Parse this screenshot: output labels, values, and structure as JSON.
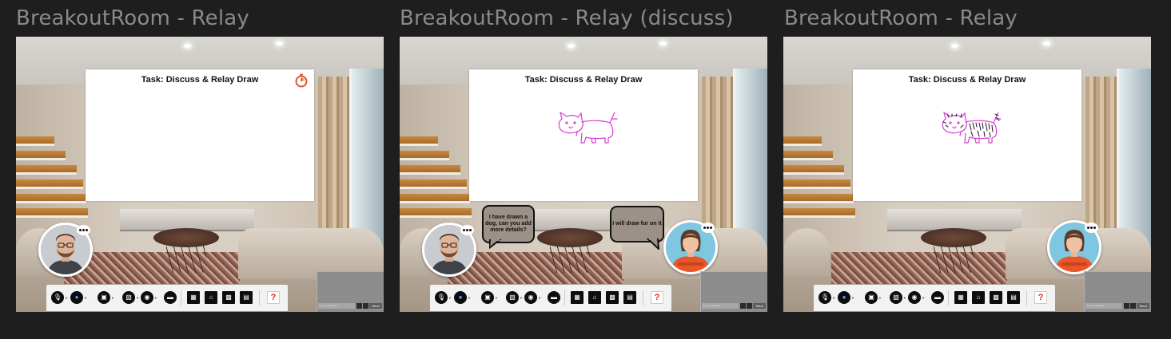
{
  "frames": [
    {
      "title": "BreakoutRoom - Relay",
      "board_title": "Task: Discuss & Relay Draw",
      "timer_icon": "stopwatch-icon",
      "drawing": "none",
      "participants": [
        "man-avatar"
      ],
      "bubbles": []
    },
    {
      "title": "BreakoutRoom - Relay (discuss)",
      "board_title": "Task: Discuss & Relay Draw",
      "drawing": "animal-sketch",
      "participants": [
        "man-avatar",
        "woman-avatar"
      ],
      "bubbles": [
        {
          "speaker": "man",
          "text": "I have drawn a dog, can you add more details?"
        },
        {
          "speaker": "woman",
          "text": "I will draw fur on it"
        }
      ]
    },
    {
      "title": "BreakoutRoom - Relay",
      "board_title": "Task: Discuss & Relay Draw",
      "drawing": "animal-sketch-with-fur",
      "participants": [
        "woman-avatar"
      ],
      "bubbles": []
    }
  ],
  "toolbar": {
    "icons": [
      "microphone-icon",
      "camera-icon",
      "video-icon",
      "screen-share-icon",
      "reaction-icon",
      "chat-icon",
      "grid-icon",
      "home-icon",
      "layout-icon",
      "notes-icon"
    ],
    "help_label": "?"
  },
  "self_view": {
    "input_placeholder": "Type a message",
    "send_label": "Send"
  },
  "colors": {
    "background": "#1e1e1e",
    "title": "#8a8a8a",
    "drawing_stroke": "#d63fd0",
    "help_accent": "#e02424"
  }
}
